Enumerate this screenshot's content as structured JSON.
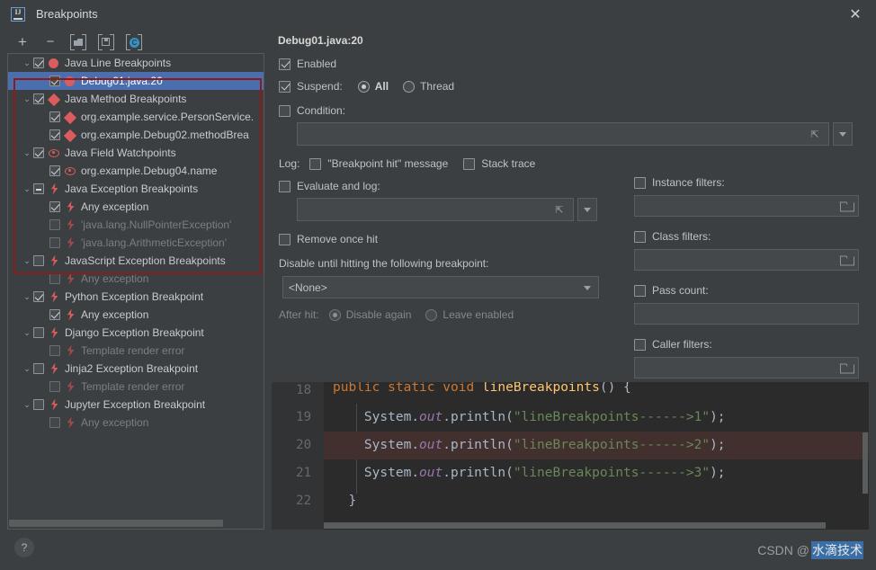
{
  "window": {
    "title": "Breakpoints",
    "logo_icon": "intellij-idea-logo",
    "close_icon": "close-icon"
  },
  "toolbar": {
    "add_label": "+",
    "remove_label": "−",
    "group_icon": "folder-icon",
    "save_icon": "disk-icon",
    "groovy_icon": "teal-circle-icon",
    "items": [
      {
        "name": "add-breakpoint-button",
        "icon": "plus-icon"
      },
      {
        "name": "remove-breakpoint-button",
        "icon": "minus-icon"
      },
      {
        "name": "group-by-file-button",
        "icon": "folder-icon"
      },
      {
        "name": "group-by-type-button",
        "icon": "disk-icon"
      },
      {
        "name": "group-by-class-button",
        "icon": "teal-circle-icon"
      }
    ]
  },
  "tree": {
    "nodes": [
      {
        "label": "Java Line Breakpoints",
        "level": 0,
        "expanded": true,
        "check": "checked",
        "icon": "breakpoint-circle",
        "dim": false,
        "selected": false
      },
      {
        "label": "Debug01.java:20",
        "level": 1,
        "expanded": null,
        "check": "checked",
        "icon": "breakpoint-circle",
        "dim": false,
        "selected": true
      },
      {
        "label": "Java Method Breakpoints",
        "level": 0,
        "expanded": true,
        "check": "checked",
        "icon": "breakpoint-diamond",
        "dim": false,
        "selected": false
      },
      {
        "label": "org.example.service.PersonService.",
        "level": 1,
        "expanded": null,
        "check": "checked",
        "icon": "breakpoint-diamond",
        "dim": false,
        "selected": false
      },
      {
        "label": "org.example.Debug02.methodBrea",
        "level": 1,
        "expanded": null,
        "check": "checked",
        "icon": "breakpoint-diamond",
        "dim": false,
        "selected": false
      },
      {
        "label": "Java Field Watchpoints",
        "level": 0,
        "expanded": true,
        "check": "checked",
        "icon": "breakpoint-eye",
        "dim": false,
        "selected": false
      },
      {
        "label": "org.example.Debug04.name",
        "level": 1,
        "expanded": null,
        "check": "checked",
        "icon": "breakpoint-eye",
        "dim": false,
        "selected": false
      },
      {
        "label": "Java Exception Breakpoints",
        "level": 0,
        "expanded": true,
        "check": "partial",
        "icon": "breakpoint-bolt",
        "dim": false,
        "selected": false
      },
      {
        "label": "Any exception",
        "level": 1,
        "expanded": null,
        "check": "checked",
        "icon": "breakpoint-bolt",
        "dim": false,
        "selected": false
      },
      {
        "label": "'java.lang.NullPointerException'",
        "level": 1,
        "expanded": null,
        "check": "unchecked",
        "icon": "breakpoint-bolt",
        "dim": true,
        "selected": false
      },
      {
        "label": "'java.lang.ArithmeticException'",
        "level": 1,
        "expanded": null,
        "check": "unchecked",
        "icon": "breakpoint-bolt",
        "dim": true,
        "selected": false
      },
      {
        "label": "JavaScript Exception Breakpoints",
        "level": 0,
        "expanded": true,
        "check": "unchecked",
        "icon": "breakpoint-bolt",
        "dim": false,
        "selected": false
      },
      {
        "label": "Any exception",
        "level": 1,
        "expanded": null,
        "check": "unchecked",
        "icon": "breakpoint-bolt",
        "dim": true,
        "selected": false
      },
      {
        "label": "Python Exception Breakpoint",
        "level": 0,
        "expanded": true,
        "check": "checked",
        "icon": "breakpoint-bolt",
        "dim": false,
        "selected": false
      },
      {
        "label": "Any exception",
        "level": 1,
        "expanded": null,
        "check": "checked",
        "icon": "breakpoint-bolt",
        "dim": false,
        "selected": false
      },
      {
        "label": "Django Exception Breakpoint",
        "level": 0,
        "expanded": true,
        "check": "unchecked",
        "icon": "breakpoint-bolt",
        "dim": false,
        "selected": false
      },
      {
        "label": "Template render error",
        "level": 1,
        "expanded": null,
        "check": "unchecked",
        "icon": "breakpoint-bolt",
        "dim": true,
        "selected": false
      },
      {
        "label": "Jinja2 Exception Breakpoint",
        "level": 0,
        "expanded": true,
        "check": "unchecked",
        "icon": "breakpoint-bolt",
        "dim": false,
        "selected": false
      },
      {
        "label": "Template render error",
        "level": 1,
        "expanded": null,
        "check": "unchecked",
        "icon": "breakpoint-bolt",
        "dim": true,
        "selected": false
      },
      {
        "label": "Jupyter Exception Breakpoint",
        "level": 0,
        "expanded": true,
        "check": "unchecked",
        "icon": "breakpoint-bolt",
        "dim": false,
        "selected": false
      },
      {
        "label": "Any exception",
        "level": 1,
        "expanded": null,
        "check": "unchecked",
        "icon": "breakpoint-bolt",
        "dim": true,
        "selected": false
      }
    ]
  },
  "details": {
    "title": "Debug01.java:20",
    "enabled_label": "Enabled",
    "enabled_checked": true,
    "suspend_label": "Suspend:",
    "suspend_checked": true,
    "suspend_all_label": "All",
    "suspend_thread_label": "Thread",
    "suspend_selected": "All",
    "condition_label": "Condition:",
    "condition_checked": false,
    "condition_value": "",
    "log_label": "Log:",
    "log_message_label": "\"Breakpoint hit\" message",
    "log_message_checked": false,
    "stack_trace_label": "Stack trace",
    "stack_trace_checked": false,
    "evaluate_and_log_label": "Evaluate and log:",
    "evaluate_and_log_checked": false,
    "evaluate_value": "",
    "remove_once_hit_label": "Remove once hit",
    "remove_once_hit_checked": false,
    "disable_until_label": "Disable until hitting the following breakpoint:",
    "disable_until_value": "<None>",
    "after_hit_label": "After hit:",
    "after_hit_disable_label": "Disable again",
    "after_hit_leave_label": "Leave enabled",
    "after_hit_selected": "Disable again"
  },
  "filters": {
    "instance_label": "Instance filters:",
    "instance_checked": false,
    "instance_value": "",
    "class_label": "Class filters:",
    "class_checked": false,
    "class_value": "",
    "pass_count_label": "Pass count:",
    "pass_count_checked": false,
    "pass_count_value": "",
    "caller_label": "Caller filters:",
    "caller_checked": false,
    "caller_value": ""
  },
  "code_preview": {
    "lines": [
      {
        "number": "18",
        "breakpoint": false,
        "highlight": false
      },
      {
        "number": "19",
        "breakpoint": false,
        "highlight": false
      },
      {
        "number": "20",
        "breakpoint": true,
        "highlight": true
      },
      {
        "number": "21",
        "breakpoint": false,
        "highlight": false
      },
      {
        "number": "22",
        "breakpoint": false,
        "highlight": false
      }
    ],
    "code": {
      "l18_kw1": "public",
      "l18_kw2": "static",
      "l18_kw3": "void",
      "l18_fn": "lineBreakpoints",
      "l18_tail": "() {",
      "l19_cls": "System",
      "l19_fld": "out",
      "l19_mth": "println",
      "l19_str": "\"lineBreakpoints------>1\"",
      "l20_str": "\"lineBreakpoints------>2\"",
      "l21_str": "\"lineBreakpoints------>3\"",
      "l22": "}"
    }
  },
  "footer": {
    "help_label": "?",
    "watermark_prefix": "CSDN @",
    "watermark_highlight": "水滴技术"
  },
  "colors": {
    "accent_selection": "#4b6eaf",
    "breakpoint_red": "#db5c5c",
    "outline_red": "#8c1c1c",
    "background": "#3c3f41",
    "editor_background": "#2b2b2b"
  }
}
